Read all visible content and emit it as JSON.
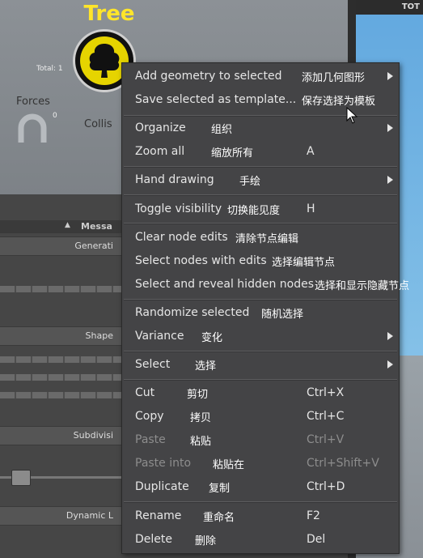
{
  "background": {
    "node_title": "Tree",
    "node_total": "Total: 1",
    "forces_label": "Forces",
    "forces_count": "0",
    "collision_label": "Collis",
    "total_button": "TOT",
    "messages_header": "Messa",
    "params": [
      "Generati",
      "Shape",
      "Subdivisi",
      "Dynamic L"
    ]
  },
  "icons": {
    "tree": "tree-icon",
    "forces": "magnet-icon",
    "submenu": "chevron-right-icon",
    "cursor": "mouse-pointer-icon"
  },
  "colors": {
    "menu_bg": "#444446",
    "menu_text": "#e6e6e6",
    "disabled_text": "#8d8d8d",
    "tree_title": "#ffe52a",
    "tree_fill": "#e6d400",
    "sky": "#7fbde6"
  },
  "menu": {
    "add_geometry": {
      "label": "Add geometry to selected",
      "cn": "添加几何图形"
    },
    "save_template": {
      "label": "Save selected as template...",
      "cn": "保存选择为模板"
    },
    "organize": {
      "label": "Organize",
      "cn": "组织"
    },
    "zoom_all": {
      "label": "Zoom all",
      "cn": "缩放所有",
      "shortcut": "A"
    },
    "hand_drawing": {
      "label": "Hand drawing",
      "cn": "手绘"
    },
    "toggle_visibility": {
      "label": "Toggle visibility",
      "cn": "切换能见度",
      "shortcut": "H"
    },
    "clear_node_edits": {
      "label": "Clear node edits",
      "cn": "清除节点编辑"
    },
    "select_nodes_edits": {
      "label": "Select nodes with edits",
      "cn": "选择编辑节点"
    },
    "select_reveal_hidden": {
      "label": "Select and reveal hidden nodes",
      "cn": "选择和显示隐藏节点"
    },
    "randomize_selected": {
      "label": "Randomize selected",
      "cn": "随机选择"
    },
    "variance": {
      "label": "Variance",
      "cn": "变化"
    },
    "select": {
      "label": "Select",
      "cn": "选择"
    },
    "cut": {
      "label": "Cut",
      "cn": "剪切",
      "shortcut": "Ctrl+X"
    },
    "copy": {
      "label": "Copy",
      "cn": "拷贝",
      "shortcut": "Ctrl+C"
    },
    "paste": {
      "label": "Paste",
      "cn": "粘贴",
      "shortcut": "Ctrl+V"
    },
    "paste_into": {
      "label": "Paste into",
      "cn": "粘贴在",
      "shortcut": "Ctrl+Shift+V"
    },
    "duplicate": {
      "label": "Duplicate",
      "cn": "复制",
      "shortcut": "Ctrl+D"
    },
    "rename": {
      "label": "Rename",
      "cn": "重命名",
      "shortcut": "F2"
    },
    "delete": {
      "label": "Delete",
      "cn": "删除",
      "shortcut": "Del"
    }
  }
}
